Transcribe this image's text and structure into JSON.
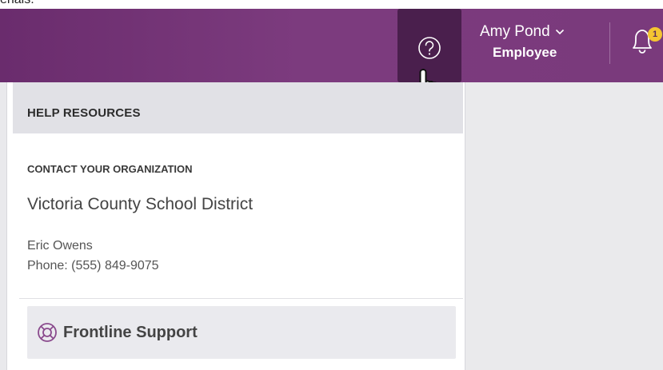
{
  "clipped_text": "erials.",
  "header": {
    "help_icon": "question-circle-icon",
    "user": {
      "name": "Amy Pond",
      "role": "Employee"
    },
    "notifications": {
      "icon": "bell-icon",
      "count": "1"
    },
    "colors": {
      "bar": "#7a3a7c",
      "active": "#4a1f4d",
      "badge": "#f4c531"
    }
  },
  "help_panel": {
    "title": "HELP RESOURCES",
    "contact_label": "CONTACT YOUR ORGANIZATION",
    "organization": "Victoria County School District",
    "contact_name": "Eric Owens",
    "contact_phone": "Phone: (555) 849-9075",
    "support_button": {
      "label": "Frontline Support",
      "icon": "lifebuoy-icon"
    }
  }
}
